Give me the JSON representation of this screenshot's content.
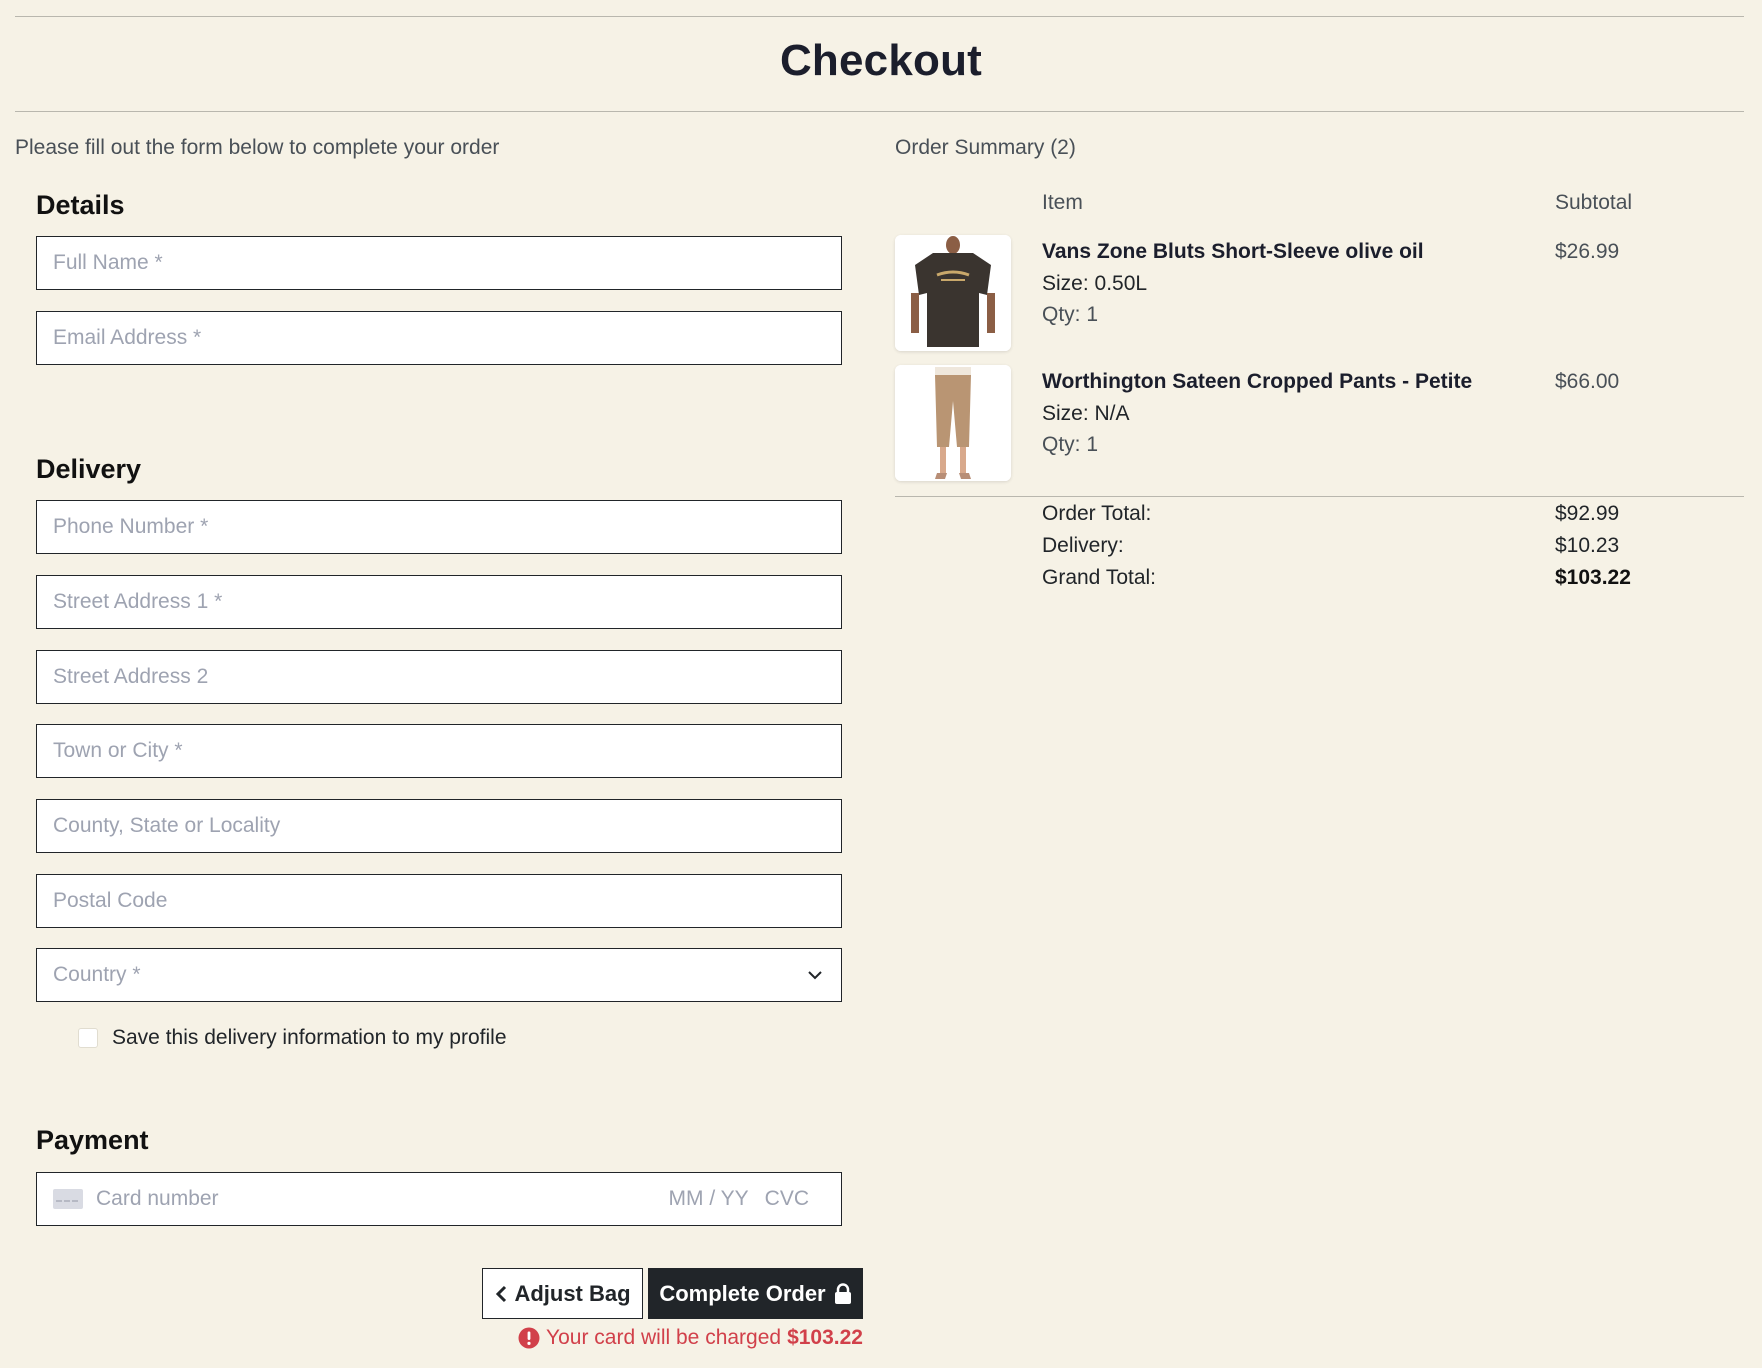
{
  "page": {
    "title": "Checkout",
    "intro": "Please fill out the form below to complete your order"
  },
  "details": {
    "heading": "Details",
    "full_name_placeholder": "Full Name *",
    "email_placeholder": "Email Address *"
  },
  "delivery": {
    "heading": "Delivery",
    "phone_placeholder": "Phone Number *",
    "street1_placeholder": "Street Address 1 *",
    "street2_placeholder": "Street Address 2",
    "town_placeholder": "Town or City *",
    "county_placeholder": "County, State or Locality",
    "postal_placeholder": "Postal Code",
    "country_placeholder": "Country *",
    "save_label": "Save this delivery information to my profile"
  },
  "payment": {
    "heading": "Payment",
    "card_placeholder": "Card number",
    "expiry_placeholder": "MM / YY",
    "cvc_placeholder": "CVC"
  },
  "actions": {
    "adjust_label": "Adjust Bag",
    "complete_label": "Complete Order",
    "charge_prefix": "Your card will be charged",
    "charge_amount": "$103.22"
  },
  "summary": {
    "title": "Order Summary (2)",
    "col_item": "Item",
    "col_subtotal": "Subtotal",
    "items": [
      {
        "name": "Vans Zone Bluts Short-Sleeve olive oil",
        "size": "Size: 0.50L",
        "qty": "Qty: 1",
        "price": "$26.99",
        "image": "t-shirt"
      },
      {
        "name": "Worthington Sateen Cropped Pants - Petite",
        "size": "Size: N/A",
        "qty": "Qty: 1",
        "price": "$66.00",
        "image": "cropped-pants"
      }
    ],
    "order_total_label": "Order Total:",
    "order_total": "$92.99",
    "delivery_label": "Delivery:",
    "delivery_value": "$10.23",
    "grand_total_label": "Grand Total:",
    "grand_total": "$103.22"
  },
  "colors": {
    "background": "#f6f2e6",
    "primary_button": "#212529",
    "error": "#d1404a"
  }
}
